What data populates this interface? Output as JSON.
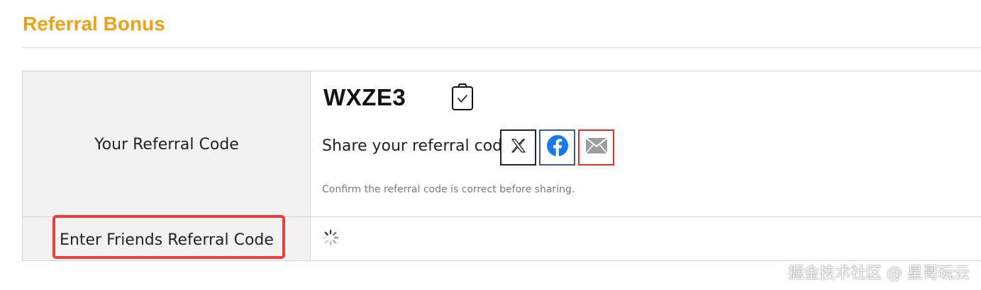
{
  "section": {
    "title": "Referral Bonus"
  },
  "rows": {
    "referral_code_label": "Your Referral Code",
    "friends_code_label": "Enter Friends Referral Code"
  },
  "referral": {
    "code": "WXZE3",
    "copy_icon": "clipboard-check-icon",
    "share_label": "Share your referral code:",
    "share_buttons": [
      {
        "icon": "x-logo-icon",
        "color": "#222222"
      },
      {
        "icon": "facebook-icon",
        "color": "#1877f2"
      },
      {
        "icon": "mail-icon",
        "color": "#d9352b"
      }
    ],
    "hint": "Confirm the referral code is correct before sharing."
  },
  "friends": {
    "loading_icon": "loading-spinner-icon"
  },
  "highlight_color": "#e8413c",
  "accent_color": "#f0a016",
  "watermark": "掘金技术社区 @ 星哥玩云"
}
